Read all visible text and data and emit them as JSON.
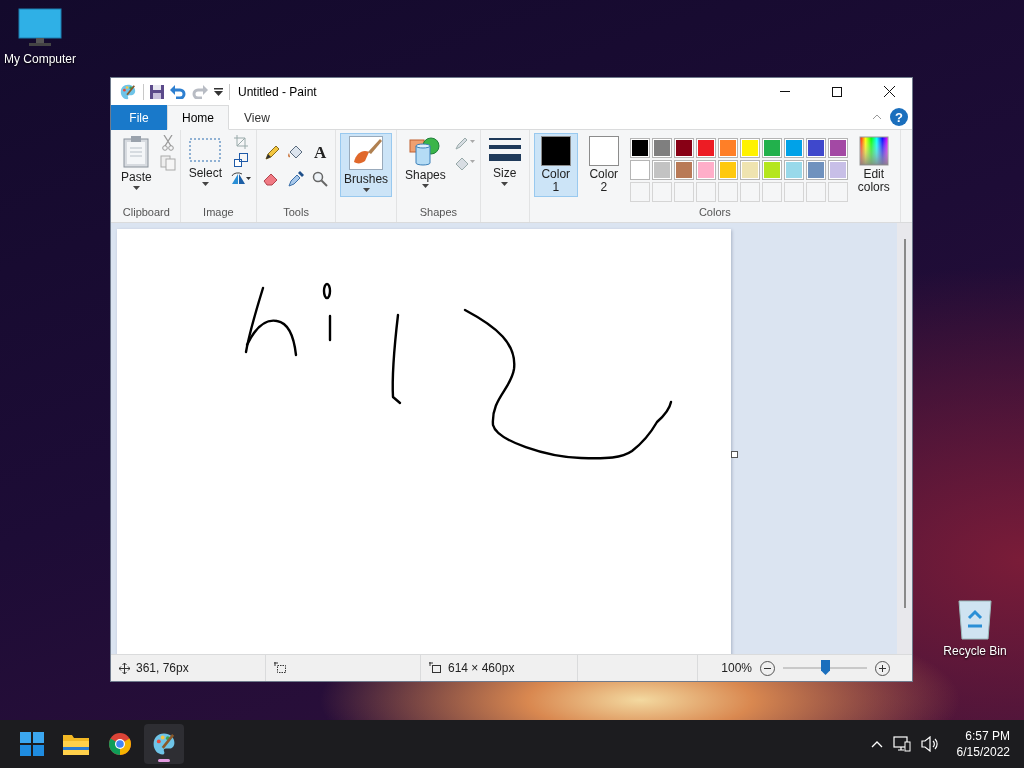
{
  "desktop_icons": [
    {
      "label": "My Computer",
      "kind": "computer"
    },
    {
      "label": "Recycle Bin",
      "kind": "bin"
    }
  ],
  "window": {
    "title": "Untitled - Paint",
    "help": "?"
  },
  "tabs": [
    {
      "label": "File",
      "kind": "file",
      "selected": false
    },
    {
      "label": "Home",
      "kind": "tab",
      "selected": true
    },
    {
      "label": "View",
      "kind": "tab",
      "selected": false
    }
  ],
  "ribbon": {
    "groups": [
      {
        "kind": "clipboard",
        "label": "Clipboard",
        "button": "Paste"
      },
      {
        "kind": "image",
        "label": "Image",
        "button": "Select"
      },
      {
        "kind": "tools",
        "label": "Tools",
        "text_tool": "A"
      },
      {
        "kind": "brushes",
        "button": "Brushes",
        "selected": true
      },
      {
        "kind": "shapes",
        "label": "Shapes",
        "button": "Shapes"
      },
      {
        "kind": "size",
        "button": "Size"
      },
      {
        "kind": "colors",
        "label": "Colors"
      }
    ]
  },
  "colors": {
    "slots": [
      {
        "label": "Color 1",
        "color": "#000000",
        "selected": true
      },
      {
        "label": "Color 2",
        "color": "#ffffff",
        "selected": false
      }
    ],
    "palette": [
      {
        "color": "#000000"
      },
      {
        "color": "#7f7f7f"
      },
      {
        "color": "#880015"
      },
      {
        "color": "#ed1c24"
      },
      {
        "color": "#ff7f27"
      },
      {
        "color": "#fff200"
      },
      {
        "color": "#22b14c"
      },
      {
        "color": "#00a2e8"
      },
      {
        "color": "#3f48cc"
      },
      {
        "color": "#a349a4"
      },
      {
        "color": "#ffffff"
      },
      {
        "color": "#c3c3c3"
      },
      {
        "color": "#b97a57"
      },
      {
        "color": "#ffaec9"
      },
      {
        "color": "#ffc90e"
      },
      {
        "color": "#efe4b0"
      },
      {
        "color": "#b5e61d"
      },
      {
        "color": "#99d9ea"
      },
      {
        "color": "#7092be"
      },
      {
        "color": "#c8bfe7"
      }
    ],
    "edit_button": "Edit colors"
  },
  "status_bar": {
    "position": "361, 76px",
    "canvas_size": "614 × 460px",
    "zoom": "100%",
    "zoom_slider": {
      "level": 0.5
    }
  },
  "taskbar": {
    "apps": [
      {
        "kind": "start",
        "selected": false
      },
      {
        "kind": "explorer",
        "selected": false
      },
      {
        "kind": "chrome",
        "selected": false
      },
      {
        "kind": "paint",
        "selected": true
      }
    ],
    "time": "6:57 PM",
    "date": "6/15/2022"
  }
}
